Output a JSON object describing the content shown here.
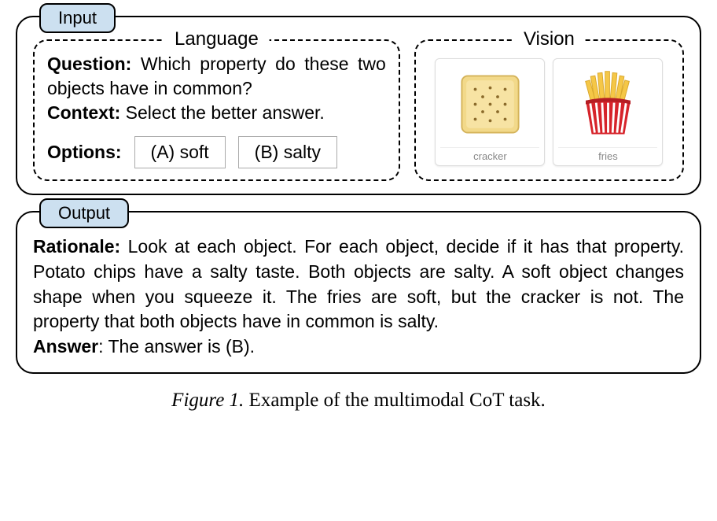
{
  "input": {
    "label": "Input",
    "language": {
      "label": "Language",
      "question_label": "Question:",
      "question_text": "Which property do these two objects have in common?",
      "context_label": "Context:",
      "context_text": "Select the better answer.",
      "options_label": "Options:",
      "options": [
        {
          "text": "(A) soft"
        },
        {
          "text": "(B) salty"
        }
      ]
    },
    "vision": {
      "label": "Vision",
      "items": [
        {
          "caption": "cracker"
        },
        {
          "caption": "fries"
        }
      ]
    }
  },
  "output": {
    "label": "Output",
    "rationale_label": "Rationale:",
    "rationale_text": "Look at each object. For each object, decide if it has that property. Potato chips have a salty taste. Both objects are salty. A soft object changes shape when you squeeze it. The fries are soft, but the cracker is not. The property that both objects have in common is salty.",
    "answer_label": "Answer",
    "answer_text": ": The answer is (B)."
  },
  "caption": {
    "fig_label": "Figure 1.",
    "text": " Example of the multimodal CoT task."
  }
}
